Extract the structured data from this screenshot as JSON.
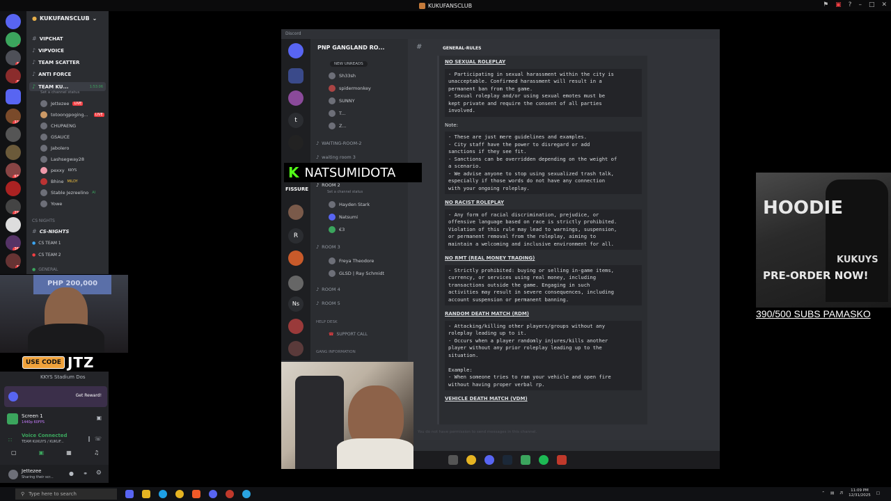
{
  "window": {
    "title": "KUKUFANSCLUB"
  },
  "sidebar": {
    "server_name": "KUKUFANSCLUB",
    "channels": [
      {
        "name": "VIPCHAT",
        "icon": "hash"
      },
      {
        "name": "VIPVOICE",
        "icon": "speaker"
      },
      {
        "name": "TEAM SCATTER",
        "icon": "speaker"
      },
      {
        "name": "ANTI FORCE",
        "icon": "speaker"
      },
      {
        "name": "TEAM KU...",
        "icon": "speaker",
        "status": "Set a channel status",
        "timer": "1:53:06"
      }
    ],
    "voice_users": [
      {
        "name": "Jettezee",
        "live": "LIVE"
      },
      {
        "name": "totoongpoging...",
        "live": "LIVE"
      },
      {
        "name": "CHUPAENG"
      },
      {
        "name": "GSAUCE"
      },
      {
        "name": "Jabolero"
      },
      {
        "name": "Lashsegway28"
      },
      {
        "name": "pexxy",
        "tag": "KKYS"
      },
      {
        "name": "Bhine",
        "tag": "MILDY"
      },
      {
        "name": "Stable Jezreelino",
        "tag": "AI"
      },
      {
        "name": "Yowe"
      }
    ],
    "categories": [
      {
        "name": "CS NIGHTS"
      },
      {
        "name": "CS-NIGHTS"
      },
      {
        "name": "CS TEAM 1"
      },
      {
        "name": "CS TEAM 2"
      },
      {
        "name": "GENERAL"
      }
    ]
  },
  "webcam_overlay": {
    "code_label": "USE CODE",
    "code": "JTZ",
    "sign": "PHP 200,000"
  },
  "lower_panel": {
    "location": "KKYS Stadium Dos",
    "reward_button": "Get Reward!",
    "screen_share": "Screen 1",
    "screen_detail": "1440p 60FPS",
    "voice_status": "Voice Connected",
    "voice_channel": "TEAM KUKUYS / KUKUF...",
    "user_name": "Jettezee",
    "user_status": "Sharing their scr..."
  },
  "shared_screen": {
    "app_label": "Discord",
    "server_name": "PNP GANGLAND RO...",
    "channel_header": "GENERAL-RULES",
    "new_unreads": "NEW UNREADS",
    "channel_users": [
      "Sh33sh",
      "spidermonkey",
      "SUNNY",
      "T...",
      "Z..."
    ],
    "voice_rooms": [
      "WAITING-ROOM-2",
      "waiting room 3",
      "ROOM 2",
      "ROOM 3",
      "ROOM 4",
      "ROOM 5"
    ],
    "room2_status": "Set a channel status",
    "room2_users": [
      "Hayden Stark",
      "Natsumi",
      "€3"
    ],
    "room3_users": [
      "Freya Theodore",
      "GLSD | Ray Schmidt"
    ],
    "helpdesk_category": "HELP DESK",
    "support_call": "SUPPORT CALL",
    "gang_category": "GANG INFORMATION",
    "rail_labels": [
      "t",
      "R",
      "Ns",
      "FISSURE"
    ],
    "rules": [
      {
        "heading": "NO SEXUAL ROLEPLAY",
        "body": "- Participating in sexual harassment within the city is\nunacceptable. Confirmed harassment will result in a\npermanent ban from the game.\n- Sexual roleplay and/or using sexual emotes must be\nkept private and require the consent of all parties\ninvolved."
      },
      {
        "heading": "Note:",
        "body": "- These are just mere guidelines and examples.\n- City staff have the power to disregard or add\nsanctions if they see fit.\n- Sanctions can be overridden depending on the weight of\na scenario.\n- We advise anyone to stop using sexualized trash talk,\nespecially if those words do not have any connection\nwith your ongoing roleplay."
      },
      {
        "heading": "NO RACIST ROLEPLAY",
        "body": "- Any form of racial discrimination, prejudice, or\noffensive language based on race is strictly prohibited.\nViolation of this rule may lead to warnings, suspension,\nor permanent removal from the roleplay, aiming to\nmaintain a welcoming and inclusive environment for all."
      },
      {
        "heading": "NO RMT (REAL MONEY TRADING)",
        "body": "- Strictly prohibited: buying or selling in-game items,\ncurrency, or services using real money, including\ntransactions outside the game. Engaging in such\nactivities may result in severe consequences, including\naccount suspension or permanent banning."
      },
      {
        "heading": "RANDOM DEATH MATCH (RDM)",
        "body": "- Attacking/killing other players/groups without any\nroleplay leading up to it.\n- Occurs when a player randomly injures/kills another\nplayer without any prior roleplay leading up to the\nsituation.\n\nExample:\n- When someone tries to ram your vehicle and open fire\nwithout having proper verbal rp."
      },
      {
        "heading": "VEHICLE DEATH MATCH (VDM)",
        "body": ""
      }
    ],
    "input_placeholder": "You do not have permission to send messages in this channel."
  },
  "streamer_overlay": {
    "k": "K",
    "name": "NATSUMIDOTA"
  },
  "ad": {
    "headline": "HOODIE",
    "preorder": "PRE-ORDER NOW!",
    "brand": "KUKUYS"
  },
  "subs_text": "390/500 SUBS PAMASKO",
  "taskbar": {
    "search_placeholder": "Type here to search",
    "time": "11:09 PM",
    "date": "12/31/2025"
  }
}
